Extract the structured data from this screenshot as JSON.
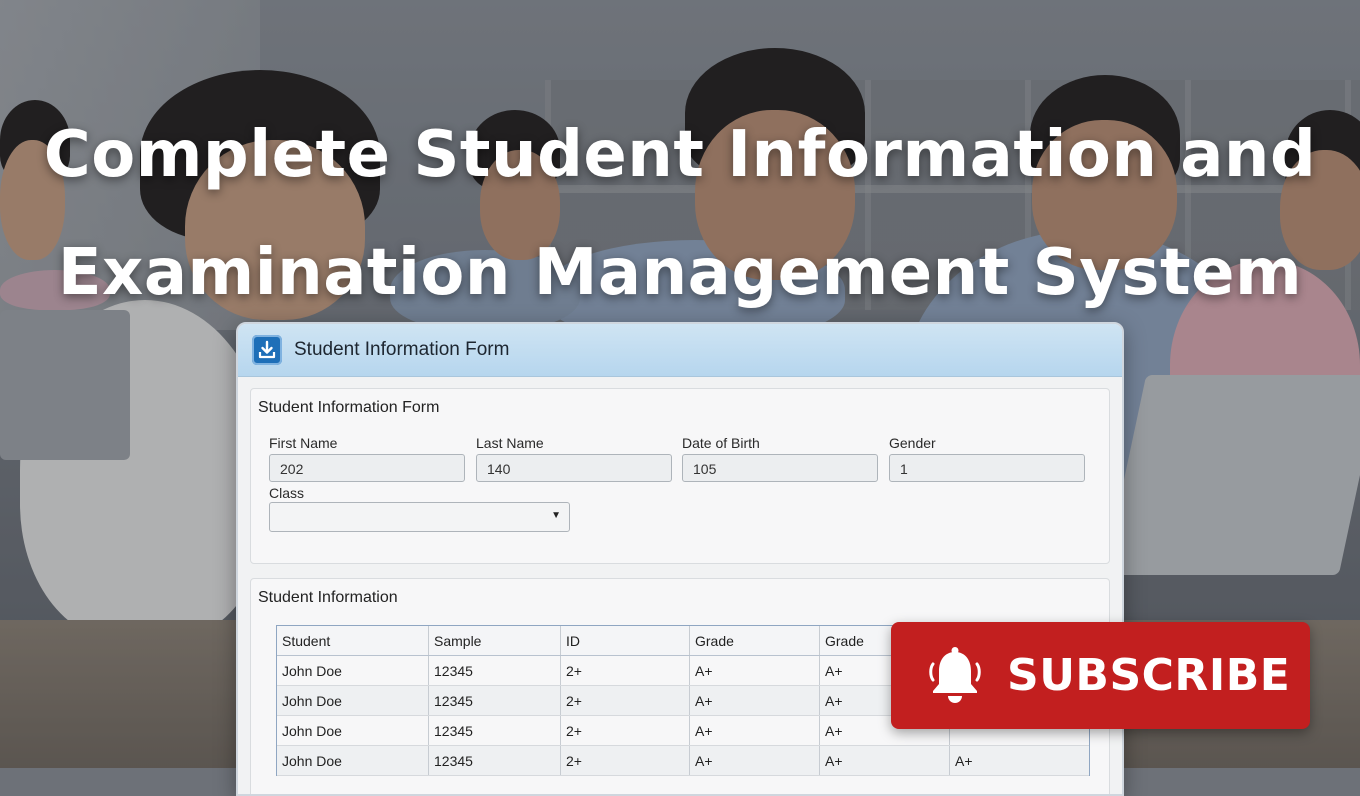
{
  "headline": {
    "line1": "Complete Student Information and",
    "line2": "Examination Management System"
  },
  "window": {
    "title": "Student Information Form",
    "icon": "download-icon"
  },
  "form": {
    "heading": "Student Information Form",
    "fields": [
      {
        "label": "First Name",
        "value": "202"
      },
      {
        "label": "Last Name",
        "value": "140"
      },
      {
        "label": "Date of Birth",
        "value": "105"
      },
      {
        "label": "Gender",
        "value": "1"
      }
    ],
    "class_label": "Class",
    "class_value": ""
  },
  "info": {
    "heading": "Student Information",
    "columns": [
      "Student",
      "Sample",
      "ID",
      "Grade",
      "Grade",
      ""
    ],
    "rows": [
      [
        "John Doe",
        "12345",
        "2+",
        "A+",
        "A+",
        ""
      ],
      [
        "John Doe",
        "12345",
        "2+",
        "A+",
        "A+",
        ""
      ],
      [
        "John Doe",
        "12345",
        "2+",
        "A+",
        "A+",
        ""
      ],
      [
        "John Doe",
        "12345",
        "2+",
        "A+",
        "A+",
        "A+"
      ]
    ]
  },
  "subscribe": {
    "label": "SUBSCRIBE",
    "icon": "bell-icon",
    "color": "#c21f1f"
  }
}
